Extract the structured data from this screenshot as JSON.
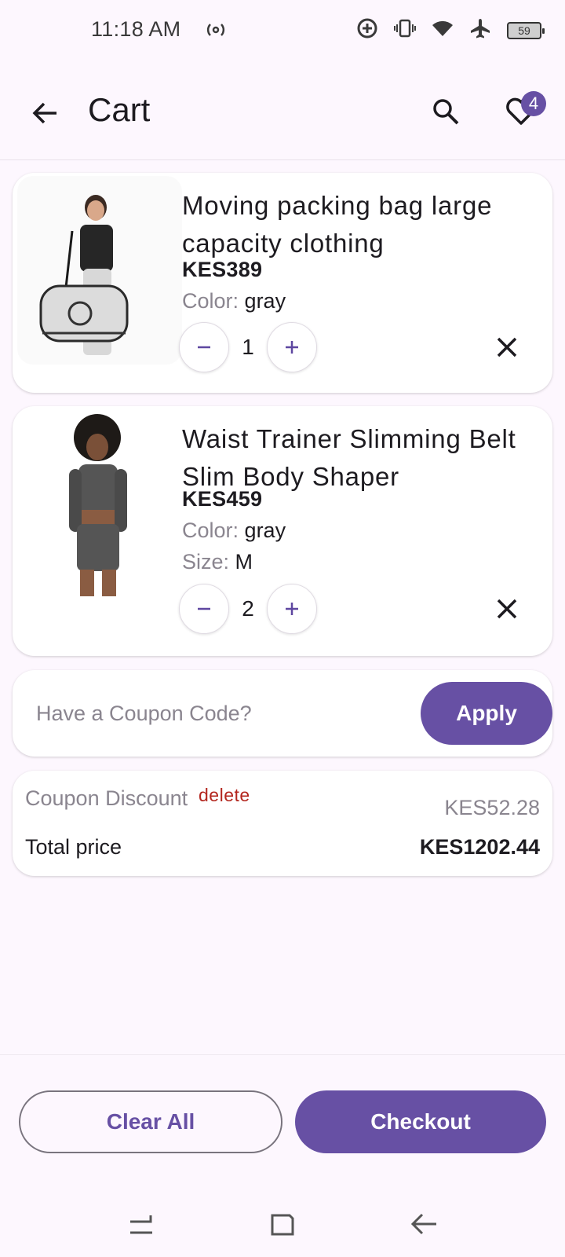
{
  "status_bar": {
    "time": "11:18 AM",
    "battery": "59",
    "icons": [
      "hotspot-icon",
      "data-saver-icon",
      "vibrate-icon",
      "wifi-icon",
      "airplane-icon",
      "battery-icon"
    ]
  },
  "app_bar": {
    "title": "Cart",
    "wishlist_count": "4"
  },
  "cart": {
    "items": [
      {
        "title": "Moving packing bag large capacity clothing",
        "price": "KES389",
        "color_label": "Color:",
        "color_value": "gray",
        "quantity": "1"
      },
      {
        "title": "Waist Trainer Slimming Belt Slim Body Shaper",
        "price": "KES459",
        "color_label": "Color:",
        "color_value": "gray",
        "size_label": "Size:",
        "size_value": "M",
        "quantity": "2"
      }
    ]
  },
  "coupon": {
    "placeholder": "Have a Coupon Code?",
    "apply_label": "Apply"
  },
  "summary": {
    "discount_label": "Coupon Discount",
    "delete_label": "delete",
    "discount_value": "KES52.28",
    "total_label": "Total price",
    "total_value": "KES1202.44"
  },
  "actions": {
    "clear_label": "Clear All",
    "checkout_label": "Checkout"
  },
  "colors": {
    "accent": "#6750a4",
    "background": "#fdf7fe",
    "danger": "#b3261e"
  }
}
